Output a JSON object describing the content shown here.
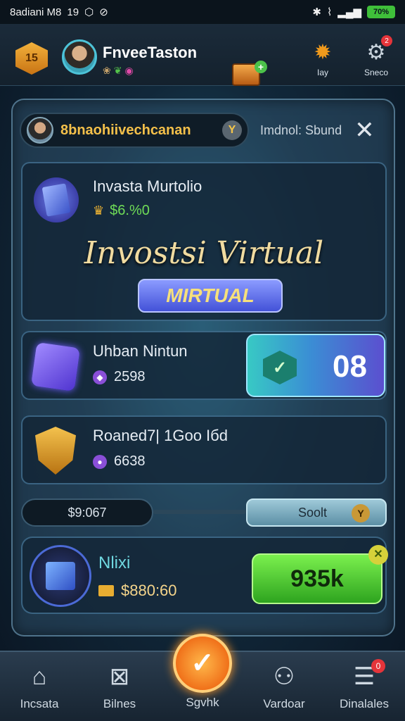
{
  "status_bar": {
    "left_text": "8adiani M8",
    "left_extra": "19",
    "battery": "70%"
  },
  "header": {
    "level_badge": "15",
    "username": "FnveeTaston",
    "activity_label": "Iay",
    "settings_label": "Sneco",
    "notification_count": "2"
  },
  "search": {
    "value": "8bnaohiivechcanan",
    "label": "Imdnol: Sbund"
  },
  "hero_card": {
    "title": "Invasta Murtolio",
    "value": "$6.%0",
    "headline": "Invostsi Virtual",
    "button_label": "MIRTUAL"
  },
  "rows": [
    {
      "title": "Uhban Nintun",
      "value": "2598",
      "counter": "08"
    },
    {
      "title": "Roaned7| 1Goo Iбd",
      "value": "6638"
    }
  ],
  "bar_row": {
    "left_value": "$9:067",
    "right_label": "Soolt"
  },
  "bottom_card": {
    "title": "Nlixi",
    "value": "$880:60",
    "button_label": "935k"
  },
  "bottom_nav": {
    "items": [
      {
        "label": "Incsata",
        "icon": "home-icon"
      },
      {
        "label": "Bilnes",
        "icon": "inbox-icon"
      },
      {
        "label": "Sgvhk",
        "icon": "check-icon"
      },
      {
        "label": "Vardoar",
        "icon": "users-icon"
      },
      {
        "label": "Dinalales",
        "icon": "list-icon"
      }
    ],
    "badge_count": "0"
  },
  "colors": {
    "accent_green": "#3fbf3a",
    "accent_orange": "#f0711a",
    "accent_gold": "#f4c04a",
    "panel_bg": "#11283a"
  }
}
